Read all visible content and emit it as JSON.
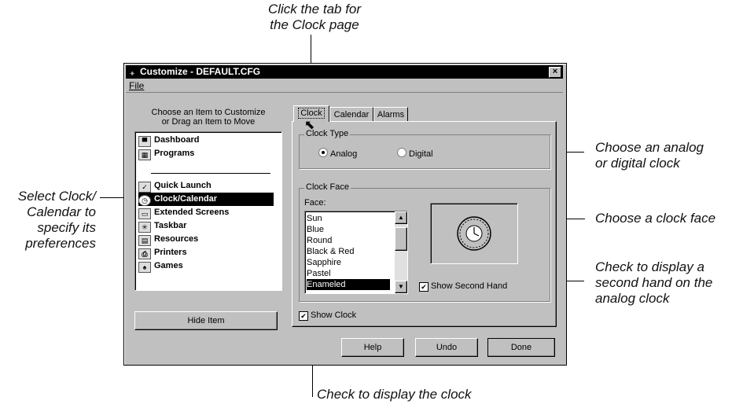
{
  "callouts": {
    "tab": [
      "Click the tab for",
      "the Clock page"
    ],
    "clock_type": [
      "Choose an analog",
      "or digital clock"
    ],
    "select_item": [
      "Select Clock/",
      "Calendar to",
      "specify its",
      "preferences"
    ],
    "clock_face": "Choose a clock face",
    "second_hand": [
      "Check to display a",
      "second hand on the",
      "analog clock"
    ],
    "show_clock": "Check to display the clock"
  },
  "window": {
    "title": "Customize - DEFAULT.CFG",
    "close": "×",
    "menu_file": "File"
  },
  "left_panel": {
    "header_line1": "Choose an Item to Customize",
    "header_line2": "or Drag an Item to Move",
    "items": [
      {
        "label": "Dashboard",
        "icon": "dashboard-icon"
      },
      {
        "label": "Programs",
        "icon": "programs-icon"
      },
      {
        "label": "Quick Launch",
        "icon": "quick-launch-icon"
      },
      {
        "label": "Clock/Calendar",
        "icon": "clock-icon",
        "selected": true
      },
      {
        "label": "Extended Screens",
        "icon": "screens-icon"
      },
      {
        "label": "Taskbar",
        "icon": "taskbar-icon"
      },
      {
        "label": "Resources",
        "icon": "resources-icon"
      },
      {
        "label": "Printers",
        "icon": "printer-icon"
      },
      {
        "label": "Games",
        "icon": "games-icon"
      }
    ],
    "hide_button": "Hide Item"
  },
  "tabs": [
    "Clock",
    "Calendar",
    "Alarms"
  ],
  "clock_type": {
    "label": "Clock Type",
    "analog": "Analog",
    "digital": "Digital",
    "selected": "Analog"
  },
  "clock_face": {
    "label": "Clock Face",
    "face_label": "Face:",
    "faces": [
      "Sun",
      "Blue",
      "Round",
      "Black & Red",
      "Sapphire",
      "Pastel",
      "Enameled"
    ],
    "selected": "Enameled",
    "show_second_hand": "Show Second Hand"
  },
  "show_clock": "Show Clock",
  "buttons": {
    "help": "Help",
    "undo": "Undo",
    "done": "Done"
  }
}
